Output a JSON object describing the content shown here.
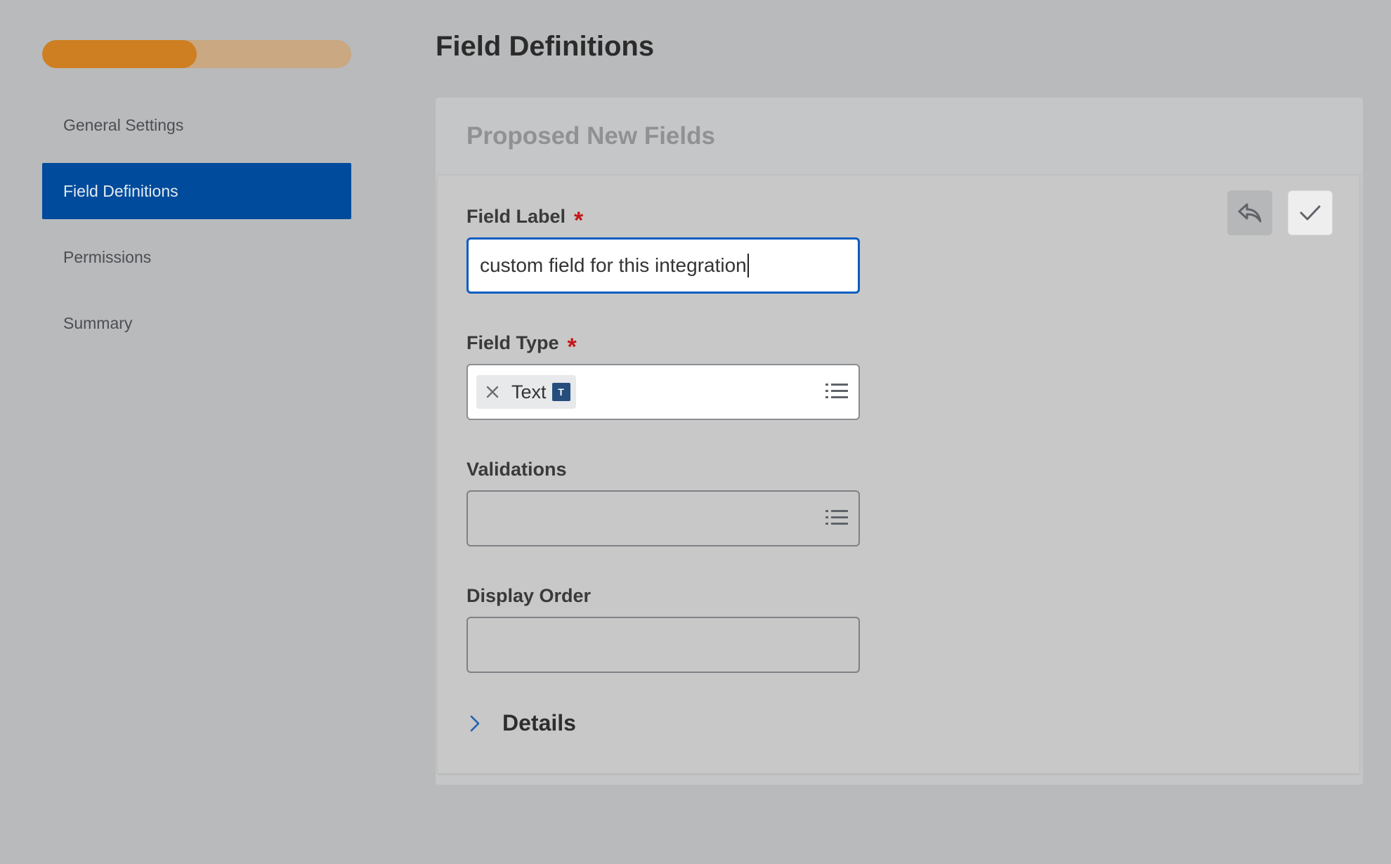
{
  "progress": {
    "fraction": 0.5
  },
  "nav": {
    "items": [
      {
        "label": "General Settings"
      },
      {
        "label": "Field Definitions",
        "active": true
      },
      {
        "label": "Permissions"
      },
      {
        "label": "Summary"
      }
    ]
  },
  "page": {
    "title": "Field Definitions"
  },
  "panel": {
    "title": "Proposed New Fields"
  },
  "form": {
    "field_label": {
      "label": "Field Label",
      "required_mark": "*",
      "value": "custom field for this integration"
    },
    "field_type": {
      "label": "Field Type",
      "required_mark": "*",
      "chip_label": "Text",
      "chip_badge": "T"
    },
    "validations": {
      "label": "Validations",
      "value": ""
    },
    "display_order": {
      "label": "Display Order",
      "value": ""
    },
    "details": {
      "label": "Details"
    }
  },
  "icons": {
    "undo": "reply-arrow-icon",
    "save": "checkmark-icon",
    "remove": "close-icon",
    "list": "list-prompt-icon",
    "expand": "chevron-right-icon"
  },
  "colors": {
    "progress_fill": "#cd7f22",
    "progress_track": "#c9a882",
    "nav_active": "#004b9b",
    "focus_border": "#0a5dc2",
    "required": "#c51717",
    "chip_badge": "#264e7c"
  }
}
